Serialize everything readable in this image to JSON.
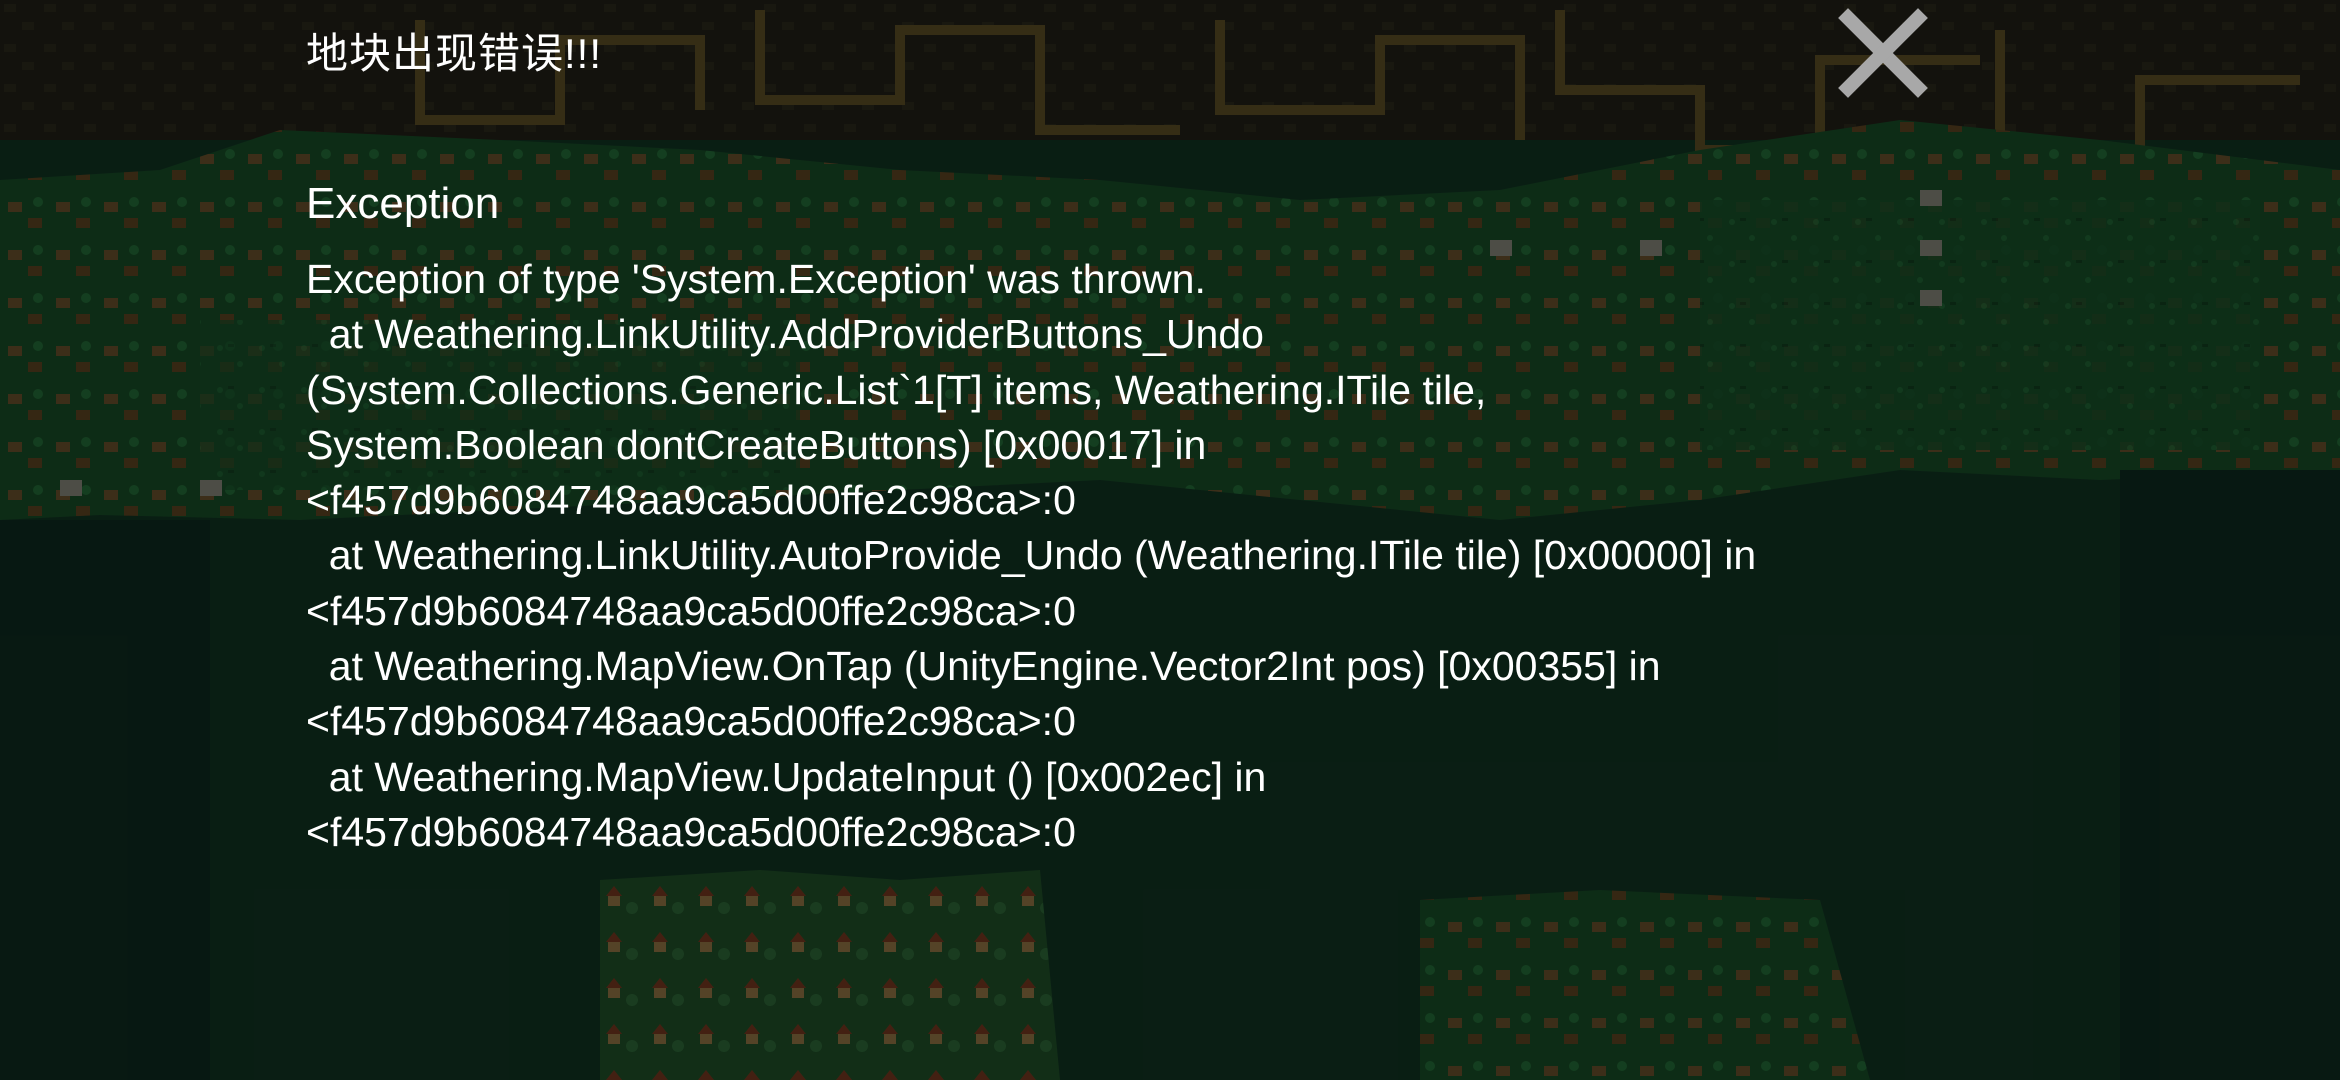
{
  "dialog": {
    "title": "地块出现错误!!!",
    "close_icon": "close-icon",
    "exception_heading": "Exception",
    "exception_lines": [
      "Exception of type 'System.Exception' was thrown.",
      "  at Weathering.LinkUtility.AddProviderButtons_Undo",
      "(System.Collections.Generic.List`1[T] items, Weathering.ITile tile,",
      "System.Boolean dontCreateButtons) [0x00017] in",
      "<f457d9b6084748aa9ca5d00ffe2c98ca>:0",
      "  at Weathering.LinkUtility.AutoProvide_Undo (Weathering.ITile tile) [0x00000] in",
      "<f457d9b6084748aa9ca5d00ffe2c98ca>:0",
      "  at Weathering.MapView.OnTap (UnityEngine.Vector2Int pos) [0x00355] in",
      "<f457d9b6084748aa9ca5d00ffe2c98ca>:0",
      "  at Weathering.MapView.UpdateInput () [0x002ec] in",
      "<f457d9b6084748aa9ca5d00ffe2c98ca>:0"
    ]
  },
  "colors": {
    "text": "#ffffff",
    "close_icon": "#a8a8a8",
    "grass": "#1c5a2f",
    "sea": "#14402a",
    "rock": "#2a2a1c",
    "road": "#6b5a2a"
  }
}
